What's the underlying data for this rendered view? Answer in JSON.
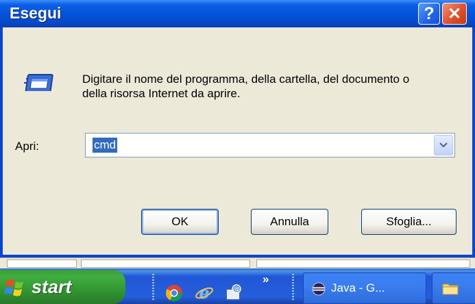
{
  "dialog": {
    "title": "Esegui",
    "help_label": "?",
    "close_label": "✕",
    "description": "Digitare il nome del programma, della cartella, del documento o della risorsa Internet da aprire.",
    "open_label": "Apri:",
    "command_value": "cmd",
    "buttons": {
      "ok": "OK",
      "cancel": "Annulla",
      "browse": "Sfoglia..."
    }
  },
  "taskbar": {
    "start_label": "start",
    "quicklaunch_overflow": "»",
    "tasks": [
      {
        "label": "Java - G...",
        "icon": "eclipse-icon"
      },
      {
        "label": "",
        "icon": "folder-icon"
      }
    ]
  },
  "colors": {
    "title_blue": "#0452d9",
    "dialog_face": "#ece9d8",
    "selection": "#316ac5",
    "start_green": "#3fae3f",
    "close_red": "#e0502b"
  }
}
